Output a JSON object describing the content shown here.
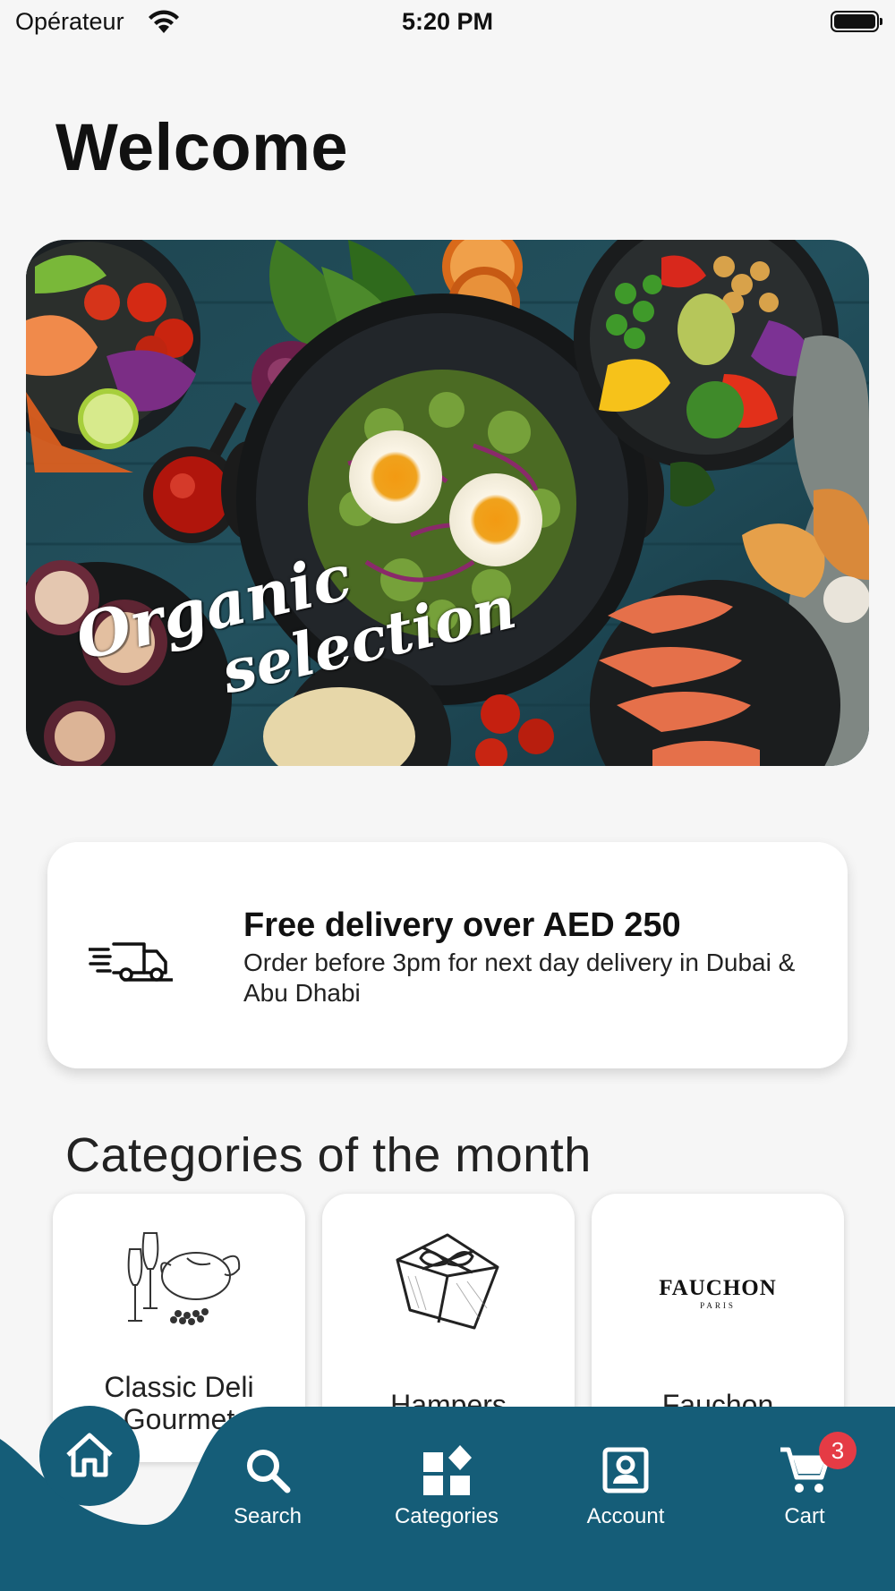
{
  "status_bar": {
    "carrier": "Opérateur",
    "time": "5:20 PM",
    "wifi_icon": "wifi-icon",
    "battery_icon": "battery-full-icon"
  },
  "page": {
    "title": "Welcome"
  },
  "hero": {
    "caption_line1": "Organic",
    "caption_line2": "selection"
  },
  "delivery": {
    "icon": "delivery-truck-icon",
    "title": "Free delivery over AED 250",
    "subtitle": "Order before 3pm for next day delivery in Dubai & Abu Dhabi"
  },
  "categories": {
    "title": "Categories of the month",
    "items": [
      {
        "label": "Classic Deli Gourmet",
        "icon": "deli-gourmet-illustration"
      },
      {
        "label": "Hampers",
        "icon": "gift-box-illustration"
      },
      {
        "label": "Fauchon",
        "icon": "fauchon-logo",
        "logo_text": "FAUCHON",
        "logo_subtext": "PARIS"
      }
    ]
  },
  "tab_bar": {
    "items": [
      {
        "label": "",
        "icon": "home-icon"
      },
      {
        "label": "Search",
        "icon": "search-icon"
      },
      {
        "label": "Categories",
        "icon": "categories-icon"
      },
      {
        "label": "Account",
        "icon": "account-icon"
      },
      {
        "label": "Cart",
        "icon": "cart-icon",
        "badge": "3"
      }
    ]
  },
  "colors": {
    "brand": "#155d78",
    "badge": "#e53b45",
    "background": "#f6f6f6",
    "card": "#ffffff"
  }
}
